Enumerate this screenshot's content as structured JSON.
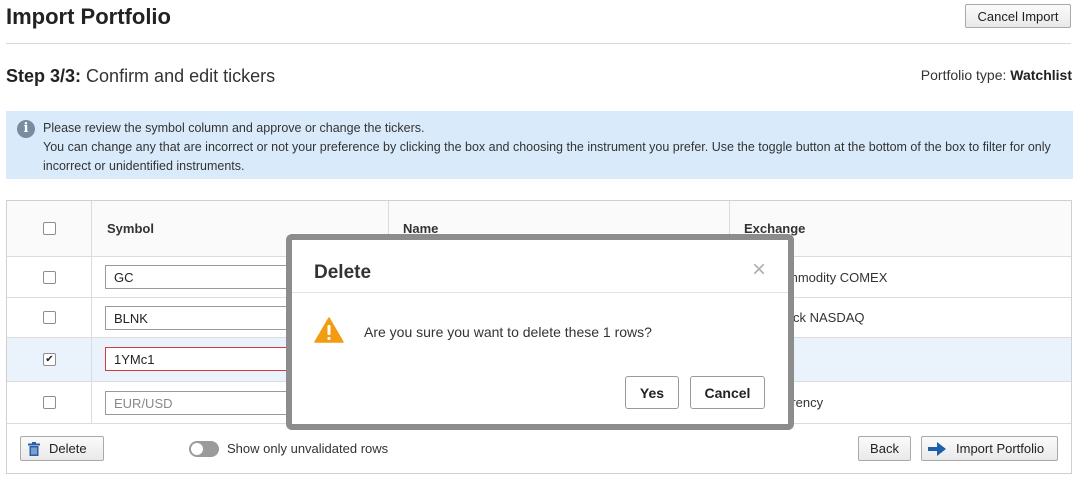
{
  "header": {
    "title": "Import Portfolio",
    "cancel_import_label": "Cancel Import"
  },
  "step": {
    "prefix": "Step 3/3:",
    "text": "Confirm and edit tickers",
    "portfolio_type_label": "Portfolio type:",
    "portfolio_type_value": "Watchlist"
  },
  "info": {
    "icon": "info-icon",
    "line1": "Please review the symbol column and approve or change the tickers.",
    "line2": "You can change any that are incorrect or not your preference by clicking the box and choosing the instrument you prefer. Use the toggle button at the bottom of the box to filter for only incorrect or unidentified instruments."
  },
  "table": {
    "columns": [
      "Symbol",
      "Name",
      "Exchange"
    ],
    "rows": [
      {
        "checked": false,
        "symbol": "GC",
        "exchange": "mmodity COMEX",
        "invalid": false,
        "placeholder": false
      },
      {
        "checked": false,
        "symbol": "BLNK",
        "exchange": "ck NASDAQ",
        "invalid": false,
        "placeholder": false
      },
      {
        "checked": true,
        "symbol": "1YMc1",
        "exchange": "",
        "invalid": true,
        "placeholder": false
      },
      {
        "checked": false,
        "symbol": "EUR/USD",
        "exchange": "rrency",
        "invalid": false,
        "placeholder": true
      }
    ]
  },
  "footer": {
    "delete_label": "Delete",
    "toggle_label": "Show only unvalidated rows",
    "back_label": "Back",
    "import_label": "Import Portfolio"
  },
  "modal": {
    "title": "Delete",
    "close_glyph": "×",
    "message": "Are you sure you want to delete these 1 rows?",
    "yes_label": "Yes",
    "cancel_label": "Cancel"
  },
  "colors": {
    "info_bg": "#d9ebfb",
    "invalid_border": "#d23b3b",
    "warning": "#f39c12",
    "import_arrow": "#1f5fa8"
  }
}
